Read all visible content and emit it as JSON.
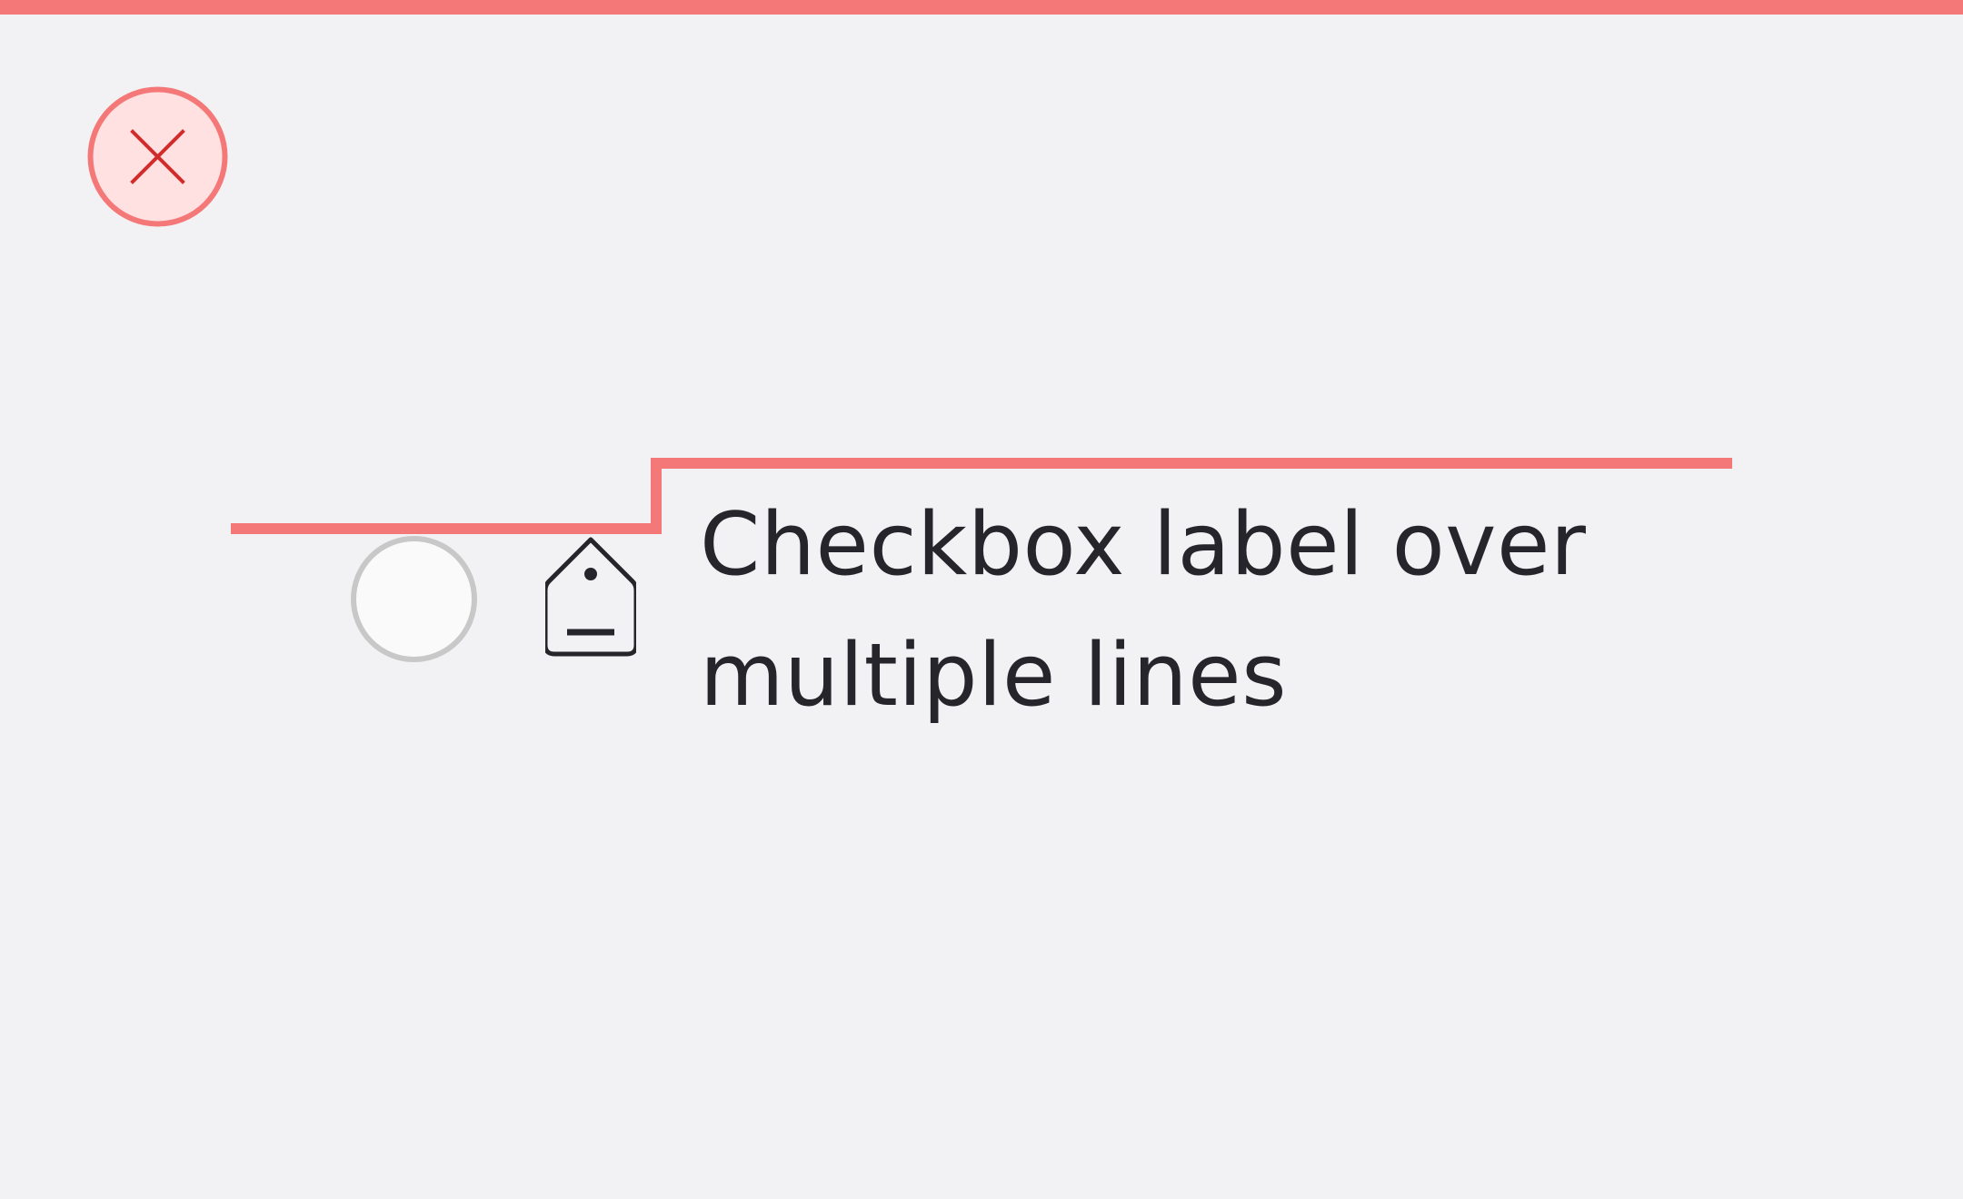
{
  "checkbox": {
    "label": "Checkbox label over multiple lines",
    "checked": false
  },
  "status": {
    "icon": "close-icon",
    "state": "error"
  },
  "icons": {
    "leading": "tag-icon"
  },
  "colors": {
    "error_accent": "#f57878",
    "error_fill": "#ffe1e1",
    "error_glyph": "#d12c2c",
    "text": "#25252b",
    "background": "#f2f2f4",
    "control_border": "#c8c8c8",
    "control_fill": "#fafafa"
  }
}
